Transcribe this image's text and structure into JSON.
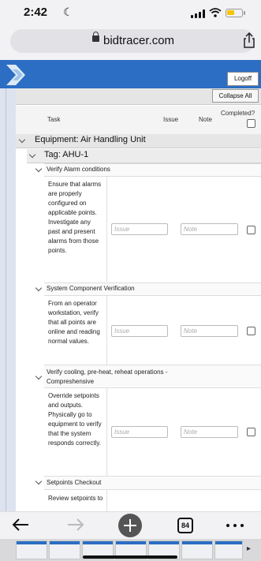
{
  "status_bar": {
    "time": "2:42",
    "icons": [
      "moon-icon",
      "signal-icon",
      "wifi-icon",
      "battery-icon"
    ],
    "battery_color": "#f5c400"
  },
  "browser": {
    "url": "bidtracer.com",
    "tab_count": "84"
  },
  "header": {
    "logoff_label": "Logoff",
    "brand_color": "#2b6ec4"
  },
  "toolbar": {
    "collapse_label": "Collapse All"
  },
  "columns": {
    "task": "Task",
    "issue": "Issue",
    "note": "Note",
    "completed": "Completed?"
  },
  "equipment": {
    "label": "Equipment: Air Handling Unit",
    "tag": "Tag: AHU-1"
  },
  "tasks": [
    {
      "title": "Verify Alarm conditions",
      "description": "Ensure that alarms are properly configured on applicable points. Investigate any past and present alarms from those points.",
      "issue_placeholder": "Issue",
      "note_placeholder": "Note"
    },
    {
      "title": "System Component Verification",
      "description": "From an operator workstation, verify that all points are online and reading normal values.",
      "issue_placeholder": "Issue",
      "note_placeholder": "Note"
    },
    {
      "title": "Verify cooling, pre-heat, reheat operations - Compreshensive",
      "description": "Override setpoints and outputs. Physically go to equipment to verify that the system responds correctly.",
      "issue_placeholder": "Issue",
      "note_placeholder": "Note"
    },
    {
      "title": "Setpoints Checkout",
      "description": "Review setpoints to"
    }
  ]
}
